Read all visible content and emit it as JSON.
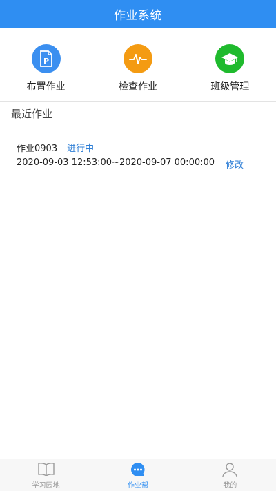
{
  "header": {
    "title": "作业系统"
  },
  "actions": [
    {
      "label": "布置作业",
      "icon": "assign-homework-icon",
      "color": "#3b8ff0"
    },
    {
      "label": "检查作业",
      "icon": "pulse-icon",
      "color": "#f49b12"
    },
    {
      "label": "班级管理",
      "icon": "graduation-cap-icon",
      "color": "#1fba2d"
    }
  ],
  "recent": {
    "title": "最近作业",
    "items": [
      {
        "name": "作业0903",
        "status": "进行中",
        "time_range": "2020-09-03 12:53:00~2020-09-07 00:00:00",
        "edit_label": "修改"
      }
    ]
  },
  "bottom_nav": [
    {
      "label": "学习园地",
      "icon": "book-icon",
      "active": false
    },
    {
      "label": "作业帮",
      "icon": "chat-bubble-icon",
      "active": true
    },
    {
      "label": "我的",
      "icon": "user-icon",
      "active": false
    }
  ],
  "colors": {
    "accent": "#2f8ef2",
    "status": "#2f7fd6"
  }
}
